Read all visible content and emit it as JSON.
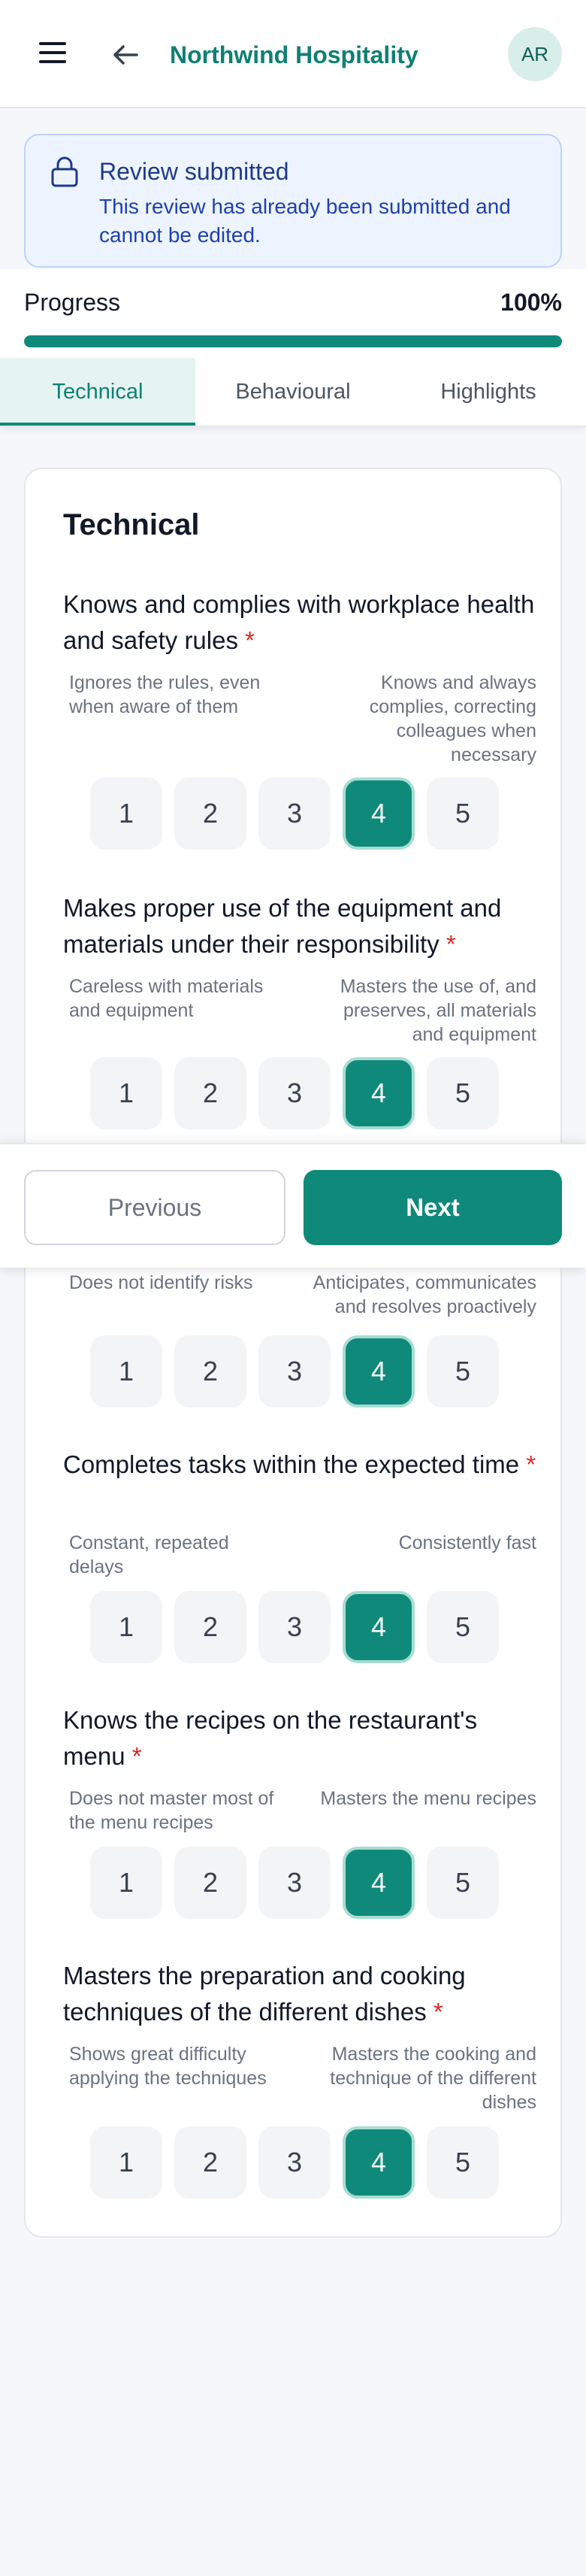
{
  "header": {
    "brand_part1": "Northwind",
    "brand_part2": "Hospitality",
    "avatar_initials": "AR"
  },
  "alert": {
    "title": "Review submitted",
    "message": "This review has already been submitted and cannot be edited."
  },
  "progress": {
    "label": "Progress",
    "percent_text": "100%",
    "value": 100
  },
  "tabs": [
    {
      "label": "Technical",
      "active": true
    },
    {
      "label": "Behavioural",
      "active": false
    },
    {
      "label": "Highlights",
      "active": false
    }
  ],
  "section": {
    "title": "Technical"
  },
  "scale_options": [
    "1",
    "2",
    "3",
    "4",
    "5"
  ],
  "questions": [
    {
      "text": "Knows and complies with workplace health and safety rules",
      "required": "*",
      "low": "Ignores the rules, even when aware of them",
      "high": "Knows and always complies, correcting colleagues when necessary",
      "selected": "4"
    },
    {
      "text": "Makes proper use of the equipment and materials under their responsibility",
      "required": "*",
      "low": "Careless with materials and equipment",
      "high": "Masters the use of, and preserves, all materials and equipment",
      "selected": "4"
    },
    {
      "text": "",
      "required": "",
      "low": "Does not identify risks",
      "high": "Anticipates, communicates and resolves proactively",
      "selected": "4"
    },
    {
      "text": "Completes tasks within the expected time",
      "required": "*",
      "low": "Constant, repeated delays",
      "high": "Consistently fast",
      "selected": "4"
    },
    {
      "text": "Knows the recipes on the restaurant's menu",
      "required": "*",
      "low": "Does not master most of the menu recipes",
      "high": "Masters the menu recipes",
      "selected": "4"
    },
    {
      "text": "Masters the preparation and cooking techniques of the different dishes",
      "required": "*",
      "low": "Shows great difficulty applying the techniques",
      "high": "Masters the cooking and technique of the different dishes",
      "selected": "4"
    }
  ],
  "footer": {
    "previous_label": "Previous",
    "next_label": "Next"
  },
  "colors": {
    "accent": "#0f8a7a",
    "alert_bg": "#eef4ff",
    "required": "#dc2626"
  },
  "icons": {
    "menu": "hamburger-menu-icon",
    "back": "arrow-left-icon",
    "lock": "lock-icon"
  }
}
